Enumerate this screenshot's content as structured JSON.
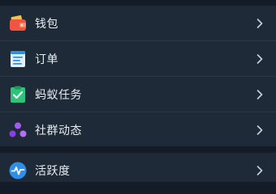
{
  "menu": {
    "items": [
      {
        "label": "钱包",
        "icon": "wallet-icon"
      },
      {
        "label": "订单",
        "icon": "receipt-icon"
      },
      {
        "label": "蚂蚁任务",
        "icon": "task-icon"
      },
      {
        "label": "社群动态",
        "icon": "community-icon"
      }
    ]
  },
  "menu2": {
    "items": [
      {
        "label": "活跃度",
        "icon": "activity-icon"
      }
    ]
  },
  "colors": {
    "background": "#141c27",
    "card": "#1f2a38",
    "text": "#e8edf3",
    "chevron": "#c9d0d8"
  }
}
